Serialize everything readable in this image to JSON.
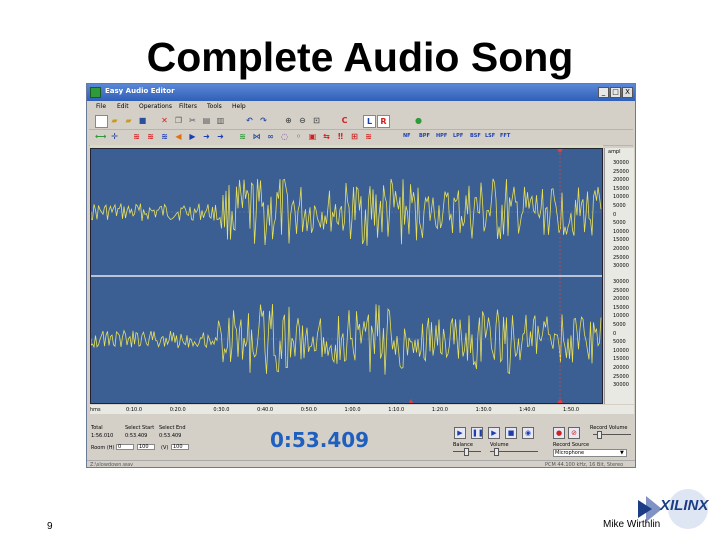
{
  "slide": {
    "title": "Complete Audio Song",
    "number": "9",
    "author": "Mike Wirthlin",
    "logo_text": "XILINX"
  },
  "app": {
    "title": "Easy Audio Editor",
    "window_buttons": [
      "_",
      "□",
      "X"
    ],
    "menu": [
      "File",
      "Edit",
      "Operations",
      "Filters",
      "Tools",
      "Help"
    ],
    "filter_buttons": [
      "NF",
      "BPF",
      "HPF",
      "LPF",
      "BSF",
      "LSF",
      "FFT"
    ],
    "channel_buttons": [
      "L",
      "R"
    ],
    "y_axis": {
      "header": "ampl",
      "channel1": [
        "30000",
        "25000",
        "20000",
        "15000",
        "10000",
        "5000",
        "0",
        "5000",
        "10000",
        "15000",
        "20000",
        "25000",
        "30000"
      ],
      "channel2": [
        "30000",
        "25000",
        "20000",
        "15000",
        "10000",
        "5000",
        "0",
        "5000",
        "10000",
        "15000",
        "20000",
        "25000",
        "30000"
      ]
    },
    "time_axis": {
      "unit": "hms",
      "ticks": [
        "0:10.0",
        "0:20.0",
        "0:30.0",
        "0:40.0",
        "0:50.0",
        "1:00.0",
        "1:10.0",
        "1:20.0",
        "1:30.0",
        "1:40.0",
        "1:50.0"
      ]
    },
    "info": {
      "total_label": "Total",
      "total_value": "1:56.010",
      "select_start_label": "Select Start",
      "select_start_value": "0:53.409",
      "select_end_label": "Select End",
      "select_end_value": "0:53.409",
      "zoom_h_label": "Room (H)",
      "zoom_h_value": "0",
      "zoom_h2": "100",
      "zoom_v_label": "(V)",
      "zoom_v_value": "100",
      "current_time": "0:53.409"
    },
    "controls": {
      "balance_label": "Balance",
      "volume_label": "Volume",
      "record_source_label": "Record Source",
      "record_source_value": "Microphone",
      "record_volume_label": "Record Volume"
    },
    "status": {
      "file": "Z:\\slowdown.wav",
      "format": "PCM 44.100 kHz, 16 Bit, Stereo"
    },
    "colors": {
      "wave_bg": "#3c5f93",
      "wave": "#e6e05a",
      "time_text": "#1f5fbf",
      "cursor": "#e04040"
    }
  }
}
